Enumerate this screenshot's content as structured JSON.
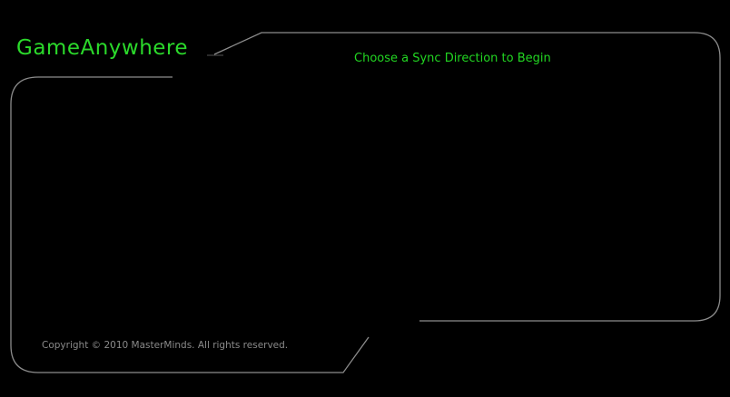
{
  "app": {
    "title": "GameAnywhere"
  },
  "main": {
    "prompt": "Choose a Sync Direction to Begin"
  },
  "footer": {
    "copyright": "Copyright © 2010 MasterMinds. All rights reserved."
  },
  "colors": {
    "background": "#000000",
    "accent_green": "#22d622",
    "frame_line": "#8c8c8c",
    "footer_text": "#8a8a8a"
  }
}
